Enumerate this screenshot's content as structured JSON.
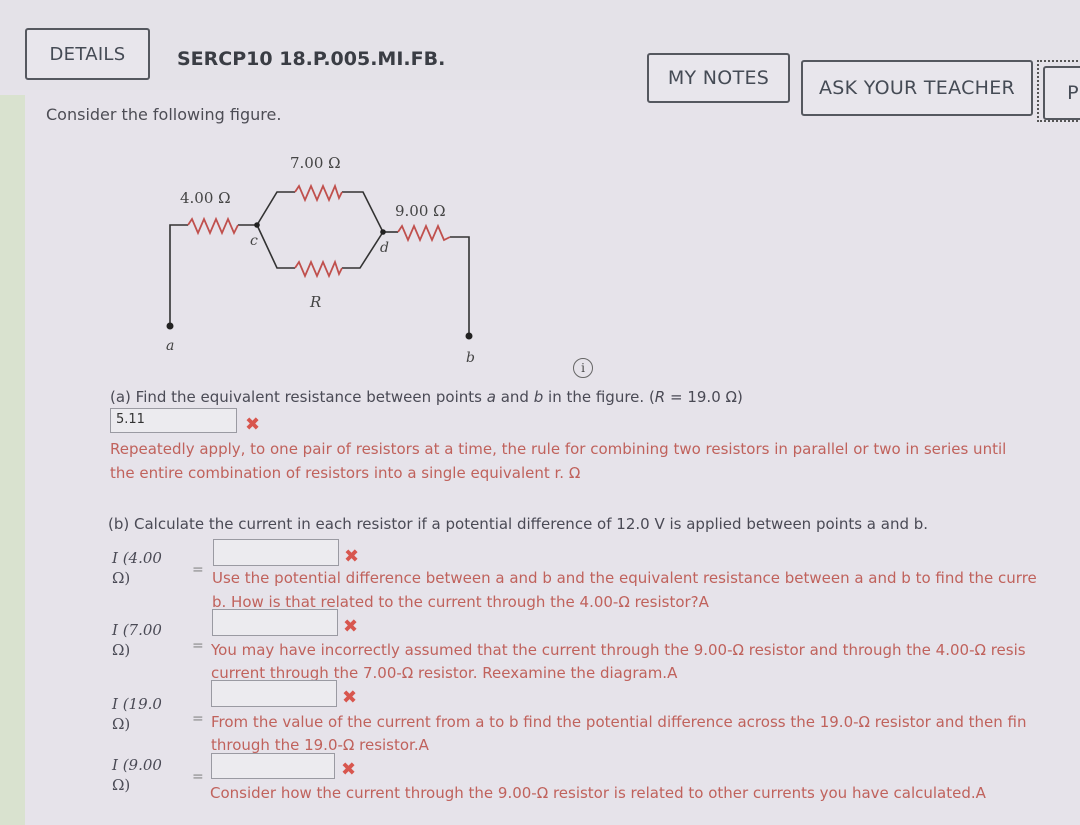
{
  "header": {
    "details_label": "DETAILS",
    "problem_id": "SERCP10 18.P.005.MI.FB.",
    "my_notes_label": "MY NOTES",
    "ask_teacher_label": "ASK YOUR TEACHER",
    "practice_label": "P"
  },
  "prompt": "Consider the following figure.",
  "figure": {
    "resistors": [
      {
        "label": "4.00 Ω"
      },
      {
        "label": "7.00 Ω"
      },
      {
        "label": "R"
      },
      {
        "label": "9.00 Ω"
      }
    ],
    "nodes": {
      "a": "a",
      "b": "b",
      "c": "c",
      "d": "d"
    },
    "wire_color": "#333333",
    "resistor_color": "#c0504d"
  },
  "part_a": {
    "question_pre": "(a) Find the equivalent resistance between points ",
    "question_a": "a",
    "question_and": " and ",
    "question_b": "b",
    "question_post": " in the figure. (",
    "question_R": "R",
    "question_value": " = 19.0 Ω)",
    "answer_value": "5.11",
    "status": "incorrect",
    "hint_line1": "Repeatedly apply, to one pair of resistors at a time, the rule for combining two resistors in parallel or two in series until",
    "hint_line2": "the entire combination of resistors into a single equivalent r. Ω"
  },
  "part_b": {
    "question": "(b) Calculate the current in each resistor if a potential difference of 12.0 V is applied between points a and b.",
    "rows": [
      {
        "label_line1": "I (4.00",
        "label_line2": "Ω)",
        "value": "",
        "status": "incorrect",
        "hint_line1": "Use the potential difference between a and b and the equivalent resistance between a and b to find the curre",
        "hint_line2": "b. How is that related to the current through the 4.00-Ω resistor?A"
      },
      {
        "label_line1": "I (7.00",
        "label_line2": "Ω)",
        "value": "",
        "status": "incorrect",
        "hint_line1": "You may have incorrectly assumed that the current through the 9.00-Ω resistor and through the 4.00-Ω resis",
        "hint_line2": "current through the 7.00-Ω resistor. Reexamine the diagram.A"
      },
      {
        "label_line1": "I (19.0",
        "label_line2": "Ω)",
        "value": "",
        "status": "incorrect",
        "hint_line1": "From the value of the current from a to b find the potential difference across the 19.0-Ω resistor and then fin",
        "hint_line2": "through the 19.0-Ω resistor.A"
      },
      {
        "label_line1": "I (9.00",
        "label_line2": "Ω)",
        "value": "",
        "status": "incorrect",
        "hint_line1": "Consider how the current through the 9.00-Ω resistor is related to other currents you have calculated.A",
        "hint_line2": ""
      }
    ]
  },
  "icons": {
    "wrong": "✖",
    "info": "i",
    "equals": "="
  },
  "colors": {
    "hint_text": "#c0625c",
    "wrong_mark": "#d8564e"
  }
}
